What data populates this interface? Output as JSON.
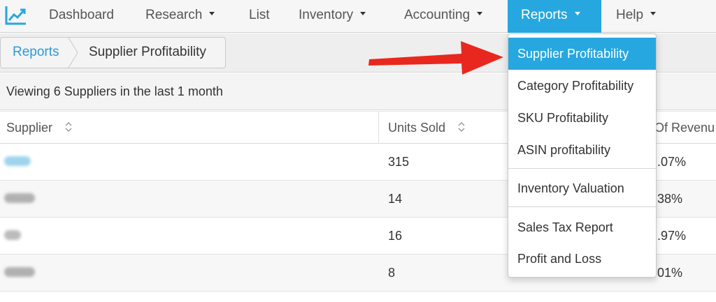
{
  "nav": {
    "items": [
      {
        "label": "Dashboard",
        "caret": false
      },
      {
        "label": "Research",
        "caret": true
      },
      {
        "label": "List",
        "caret": false
      },
      {
        "label": "Inventory",
        "caret": true
      },
      {
        "label": "Accounting",
        "caret": true
      },
      {
        "label": "Reports",
        "caret": true,
        "active": true
      },
      {
        "label": "Help",
        "caret": true
      }
    ]
  },
  "breadcrumb": {
    "root": "Reports",
    "current": "Supplier Profitability"
  },
  "summary": {
    "text": "Viewing 6 Suppliers in the last 1 month"
  },
  "table": {
    "columns": [
      "Supplier",
      "Units Sold",
      "Of Revenu"
    ],
    "rows": [
      {
        "supplier": "",
        "units": "315",
        "pct": ".07%"
      },
      {
        "supplier": "",
        "units": "14",
        "pct": "38%"
      },
      {
        "supplier": "",
        "units": "16",
        "pct": ".97%"
      },
      {
        "supplier": "",
        "units": "8",
        "pct": "01%"
      }
    ]
  },
  "reports_menu": {
    "items": [
      "Supplier Profitability",
      "Category Profitability",
      "SKU Profitability",
      "ASIN profitability",
      "Inventory Valuation",
      "Sales Tax Report",
      "Profit and Loss"
    ]
  },
  "colors": {
    "accent": "#27a7df",
    "link": "#2a9bd4",
    "annotation_arrow": "#e8281e"
  },
  "icons": [
    "chart-logo-icon",
    "chevron-down-icon",
    "sort-icon",
    "breadcrumb-separator-icon",
    "annotation-arrow-icon"
  ]
}
